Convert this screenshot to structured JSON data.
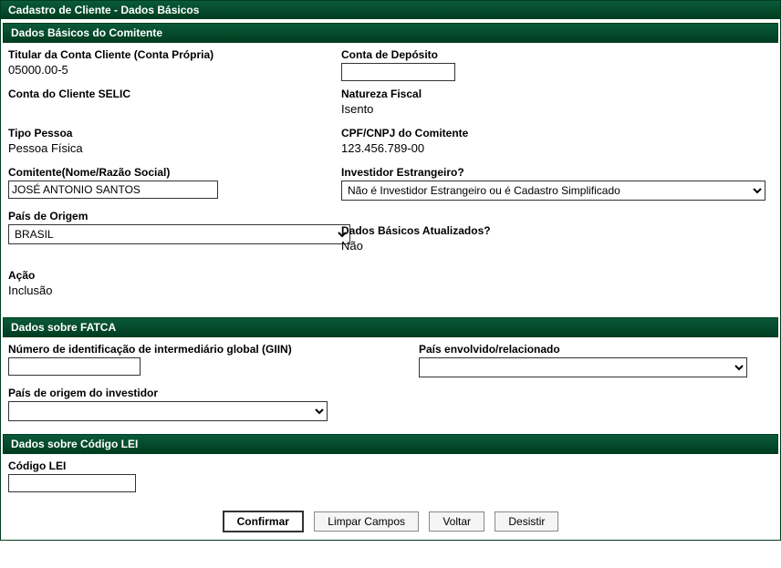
{
  "headers": {
    "pageTitle": "Cadastro de Cliente - Dados Básicos",
    "section1": "Dados Básicos do Comitente",
    "section2": "Dados sobre FATCA",
    "section3": "Dados sobre Código LEI"
  },
  "basicos": {
    "titularLabel": "Titular da Conta Cliente (Conta Própria)",
    "titularValue": "05000.00-5",
    "contaDepositoLabel": "Conta de Depósito",
    "contaDepositoValue": "",
    "contaSelicLabel": "Conta do Cliente SELIC",
    "contaSelicValue": "",
    "naturezaFiscalLabel": "Natureza Fiscal",
    "naturezaFiscalValue": "Isento",
    "tipoPessoaLabel": "Tipo Pessoa",
    "tipoPessoaValue": "Pessoa Física",
    "cpfLabel": "CPF/CNPJ do Comitente",
    "cpfValue": "123.456.789-00",
    "comitenteLabel": "Comitente(Nome/Razão Social)",
    "comitenteValue": "JOSÉ ANTONIO SANTOS",
    "investidorLabel": "Investidor Estrangeiro?",
    "investidorValue": "Não é Investidor Estrangeiro ou é Cadastro Simplificado",
    "paisOrigemLabel": "País de Origem",
    "paisOrigemValue": "BRASIL",
    "dadosAtualizadosLabel": "Dados Básicos Atualizados?",
    "dadosAtualizadosValue": "Não",
    "acaoLabel": "Ação",
    "acaoValue": "Inclusão"
  },
  "fatca": {
    "giinLabel": "Número de identificação de intermediário global (GIIN)",
    "giinValue": "",
    "paisEnvLabel": "País envolvido/relacionado",
    "paisEnvValue": "",
    "paisOrigemInvLabel": "País de origem do investidor",
    "paisOrigemInvValue": ""
  },
  "lei": {
    "codigoLabel": "Código LEI",
    "codigoValue": ""
  },
  "buttons": {
    "confirmar": "Confirmar",
    "limpar": "Limpar Campos",
    "voltar": "Voltar",
    "desistir": "Desistir"
  }
}
